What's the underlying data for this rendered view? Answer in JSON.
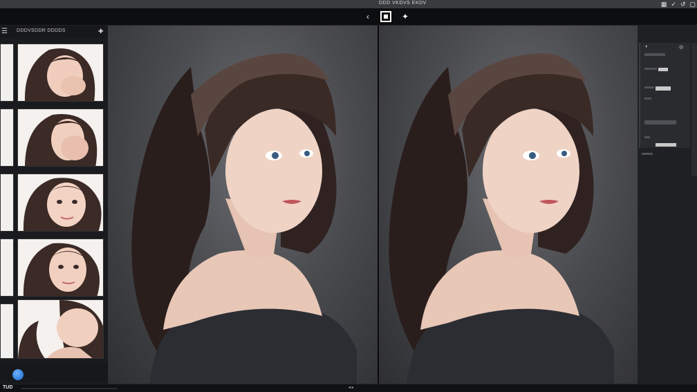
{
  "window": {
    "title": "DDD VKDVS EKDV",
    "title_icons": [
      "grid-icon",
      "checkmark-icon",
      "rotate-icon",
      "pages-icon"
    ]
  },
  "toolbar": {
    "back_icon": "chevron-left-icon",
    "crop_icon": "crop-square-icon",
    "sparkle_icon": "sparkle-icon"
  },
  "sidebar": {
    "header_label": "DDDVSDDR DDDDS",
    "thumbnails": [
      {
        "name": "photo-1"
      },
      {
        "name": "photo-2"
      },
      {
        "name": "photo-3"
      },
      {
        "name": "photo-4"
      },
      {
        "name": "photo-5"
      }
    ]
  },
  "panel": {
    "sections": [
      "",
      "",
      "",
      ""
    ]
  },
  "status": {
    "tag": "TUD"
  },
  "colors": {
    "accent": "#1e6fd9",
    "background": "#151618",
    "canvas": "#4b4c50"
  }
}
